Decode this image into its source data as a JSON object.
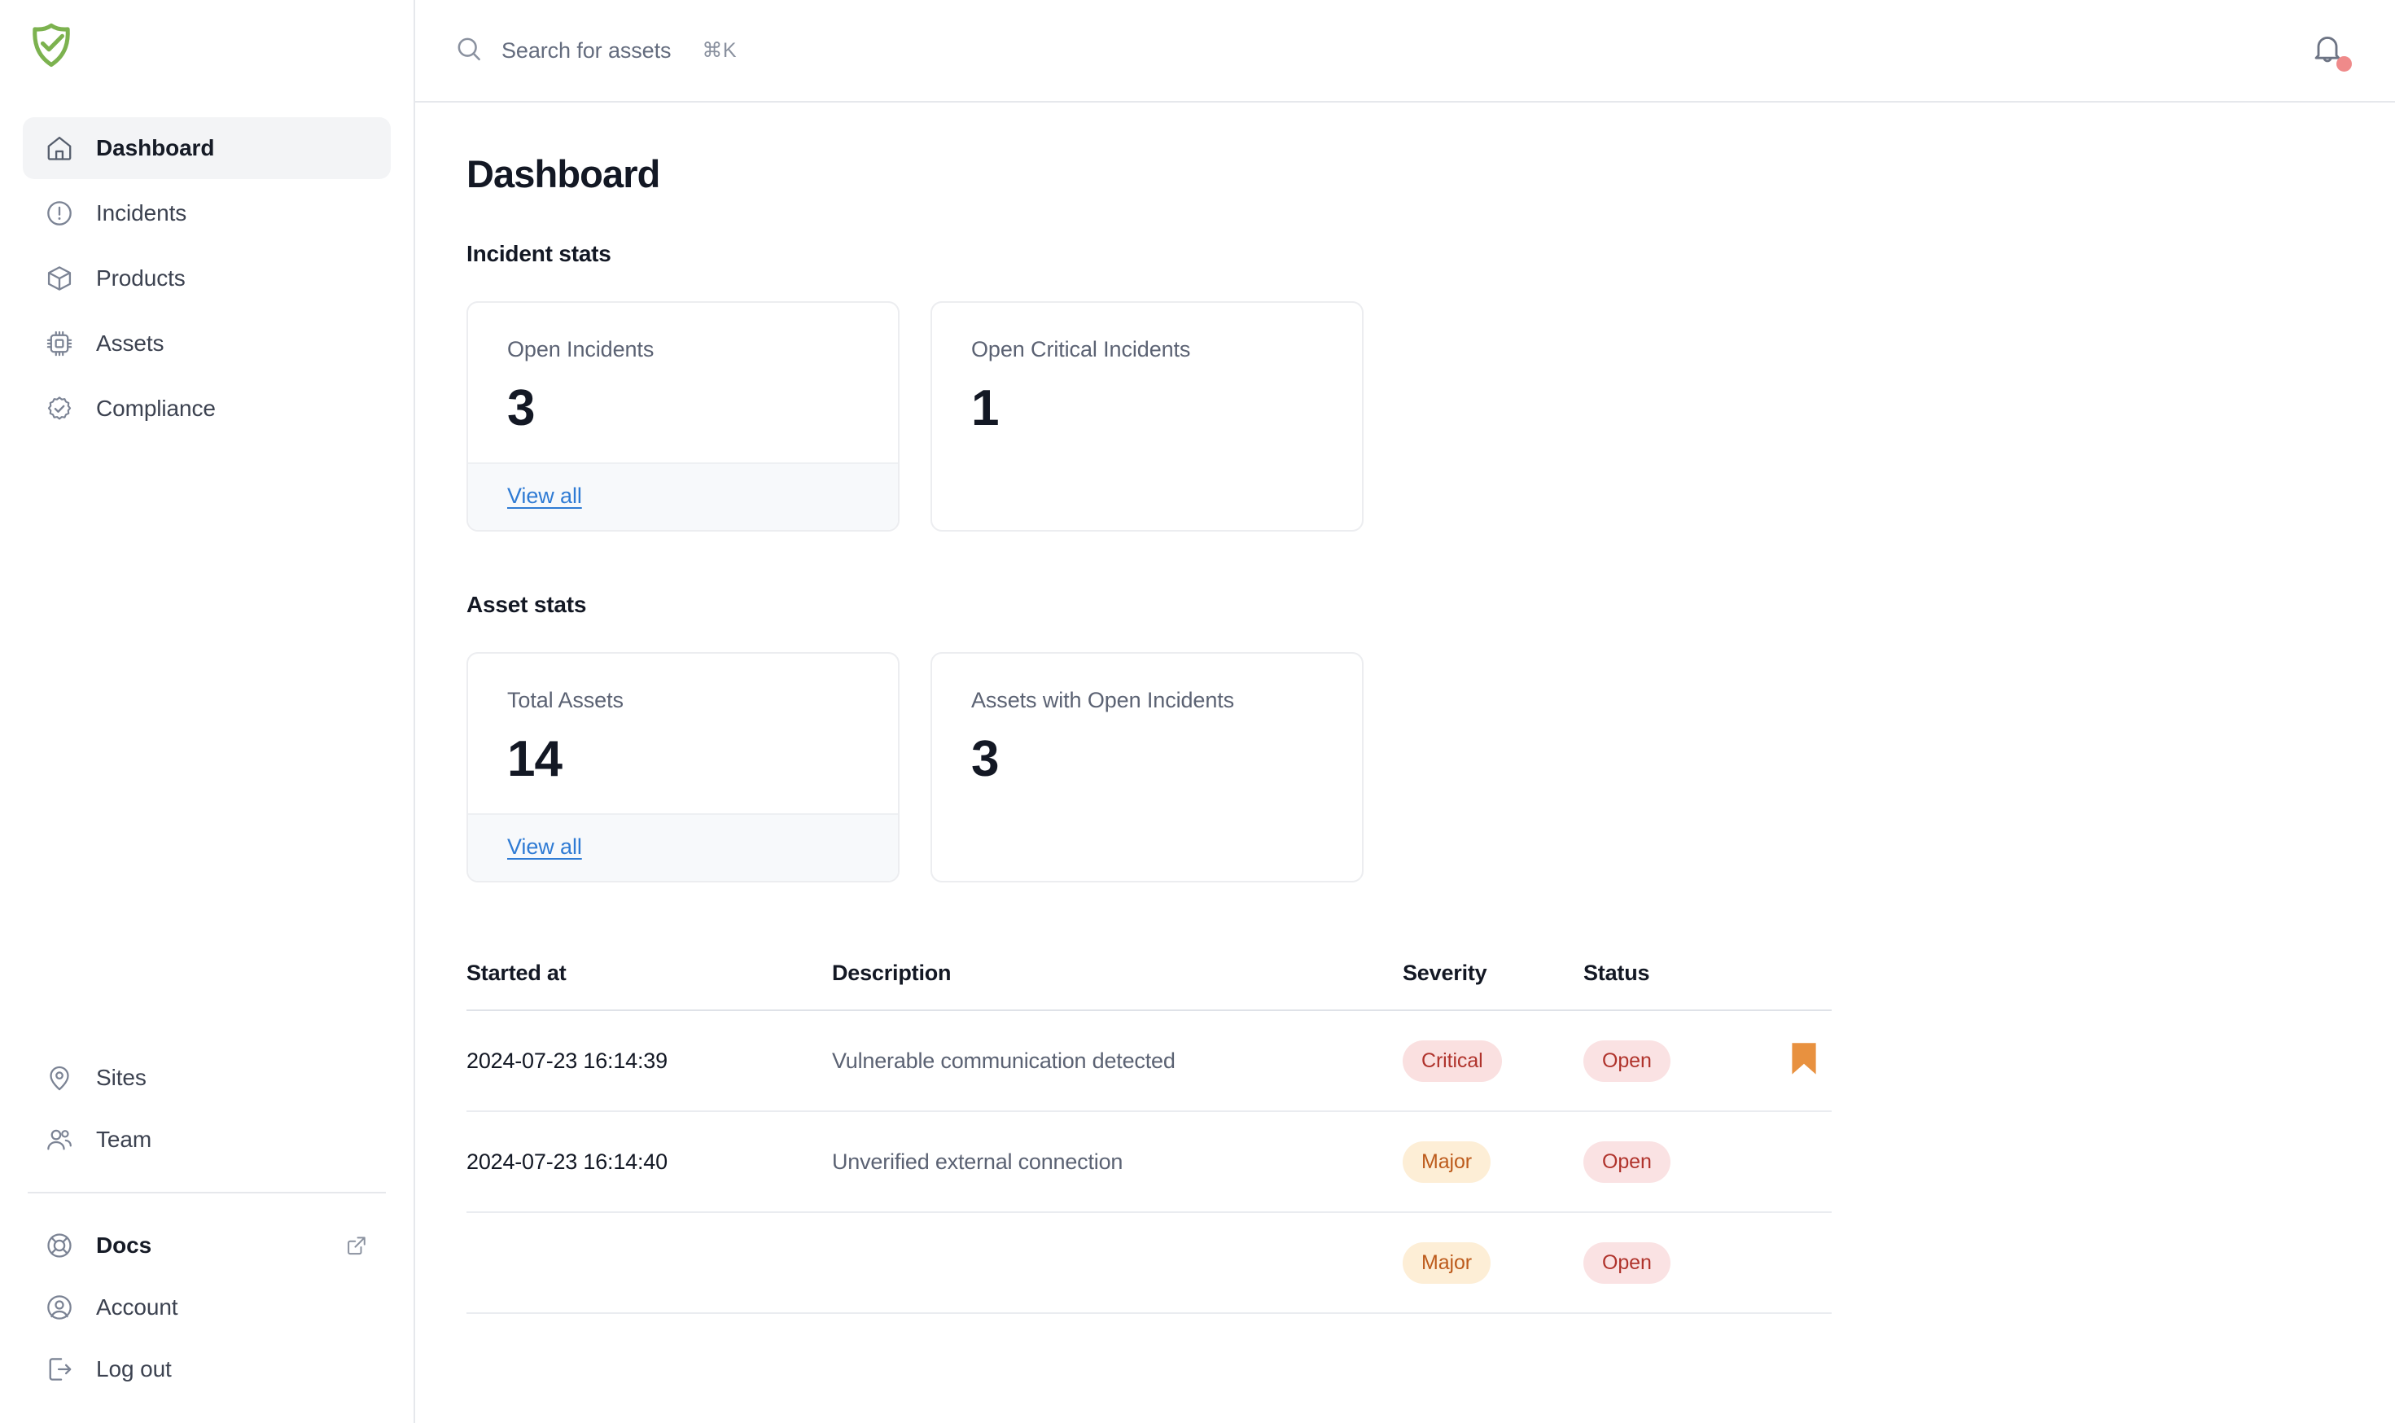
{
  "brand": {
    "logo_icon": "shield-check-icon",
    "logo_color": "#7cb24f"
  },
  "sidebar": {
    "primary_items": [
      {
        "label": "Dashboard",
        "icon": "home-icon",
        "active": true
      },
      {
        "label": "Incidents",
        "icon": "alert-circle-icon",
        "active": false
      },
      {
        "label": "Products",
        "icon": "cube-icon",
        "active": false
      },
      {
        "label": "Assets",
        "icon": "chip-icon",
        "active": false
      },
      {
        "label": "Compliance",
        "icon": "badge-check-icon",
        "active": false
      }
    ],
    "secondary_items": [
      {
        "label": "Sites",
        "icon": "map-pin-icon"
      },
      {
        "label": "Team",
        "icon": "users-icon"
      }
    ],
    "footer_items": [
      {
        "label": "Docs",
        "icon": "lifebuoy-icon",
        "external_icon": "external-link-icon",
        "bold": true
      },
      {
        "label": "Account",
        "icon": "user-circle-icon",
        "external_icon": null,
        "bold": false
      },
      {
        "label": "Log out",
        "icon": "logout-icon",
        "external_icon": null,
        "bold": false
      }
    ]
  },
  "topbar": {
    "search_icon": "search-icon",
    "search_placeholder": "Search for assets",
    "search_value": "",
    "search_shortcut": "⌘K",
    "notifications_icon": "bell-icon",
    "has_unread": true,
    "unread_dot_color": "#ef8a8a"
  },
  "page": {
    "title": "Dashboard"
  },
  "incident_stats": {
    "heading": "Incident stats",
    "cards": [
      {
        "label": "Open Incidents",
        "value": "3",
        "link_label": "View all",
        "has_footer": true
      },
      {
        "label": "Open Critical Incidents",
        "value": "1",
        "link_label": "",
        "has_footer": false
      }
    ]
  },
  "asset_stats": {
    "heading": "Asset stats",
    "cards": [
      {
        "label": "Total Assets",
        "value": "14",
        "link_label": "View all",
        "has_footer": true
      },
      {
        "label": "Assets with Open Incidents",
        "value": "3",
        "link_label": "",
        "has_footer": false
      }
    ]
  },
  "incidents_table": {
    "columns": [
      "Started at",
      "Description",
      "Severity",
      "Status",
      ""
    ],
    "rows": [
      {
        "started_at": "2024-07-23 16:14:39",
        "description": "Vulnerable communication detected",
        "severity": "Critical",
        "severity_kind": "critical",
        "status": "Open",
        "status_kind": "open",
        "flagged": true,
        "flag_icon": "bookmark-icon",
        "flag_color": "#e8913f"
      },
      {
        "started_at": "2024-07-23 16:14:40",
        "description": "Unverified external connection",
        "severity": "Major",
        "severity_kind": "major",
        "status": "Open",
        "status_kind": "open",
        "flagged": false,
        "flag_icon": null,
        "flag_color": ""
      },
      {
        "started_at": "",
        "description": "",
        "severity": "Major",
        "severity_kind": "major",
        "status": "Open",
        "status_kind": "open",
        "flagged": false,
        "flag_icon": null,
        "flag_color": ""
      }
    ]
  },
  "colors": {
    "accent_green": "#7cb24f",
    "link_blue": "#2f7bd4",
    "critical_bg": "#fae0e0",
    "critical_fg": "#b0332c",
    "major_bg": "#fdeed6",
    "major_fg": "#bd5b1c",
    "open_bg": "#fae2e3",
    "open_fg": "#b0332c",
    "flag_orange": "#e8913f",
    "sidebar_active_bg": "#f3f4f6"
  }
}
